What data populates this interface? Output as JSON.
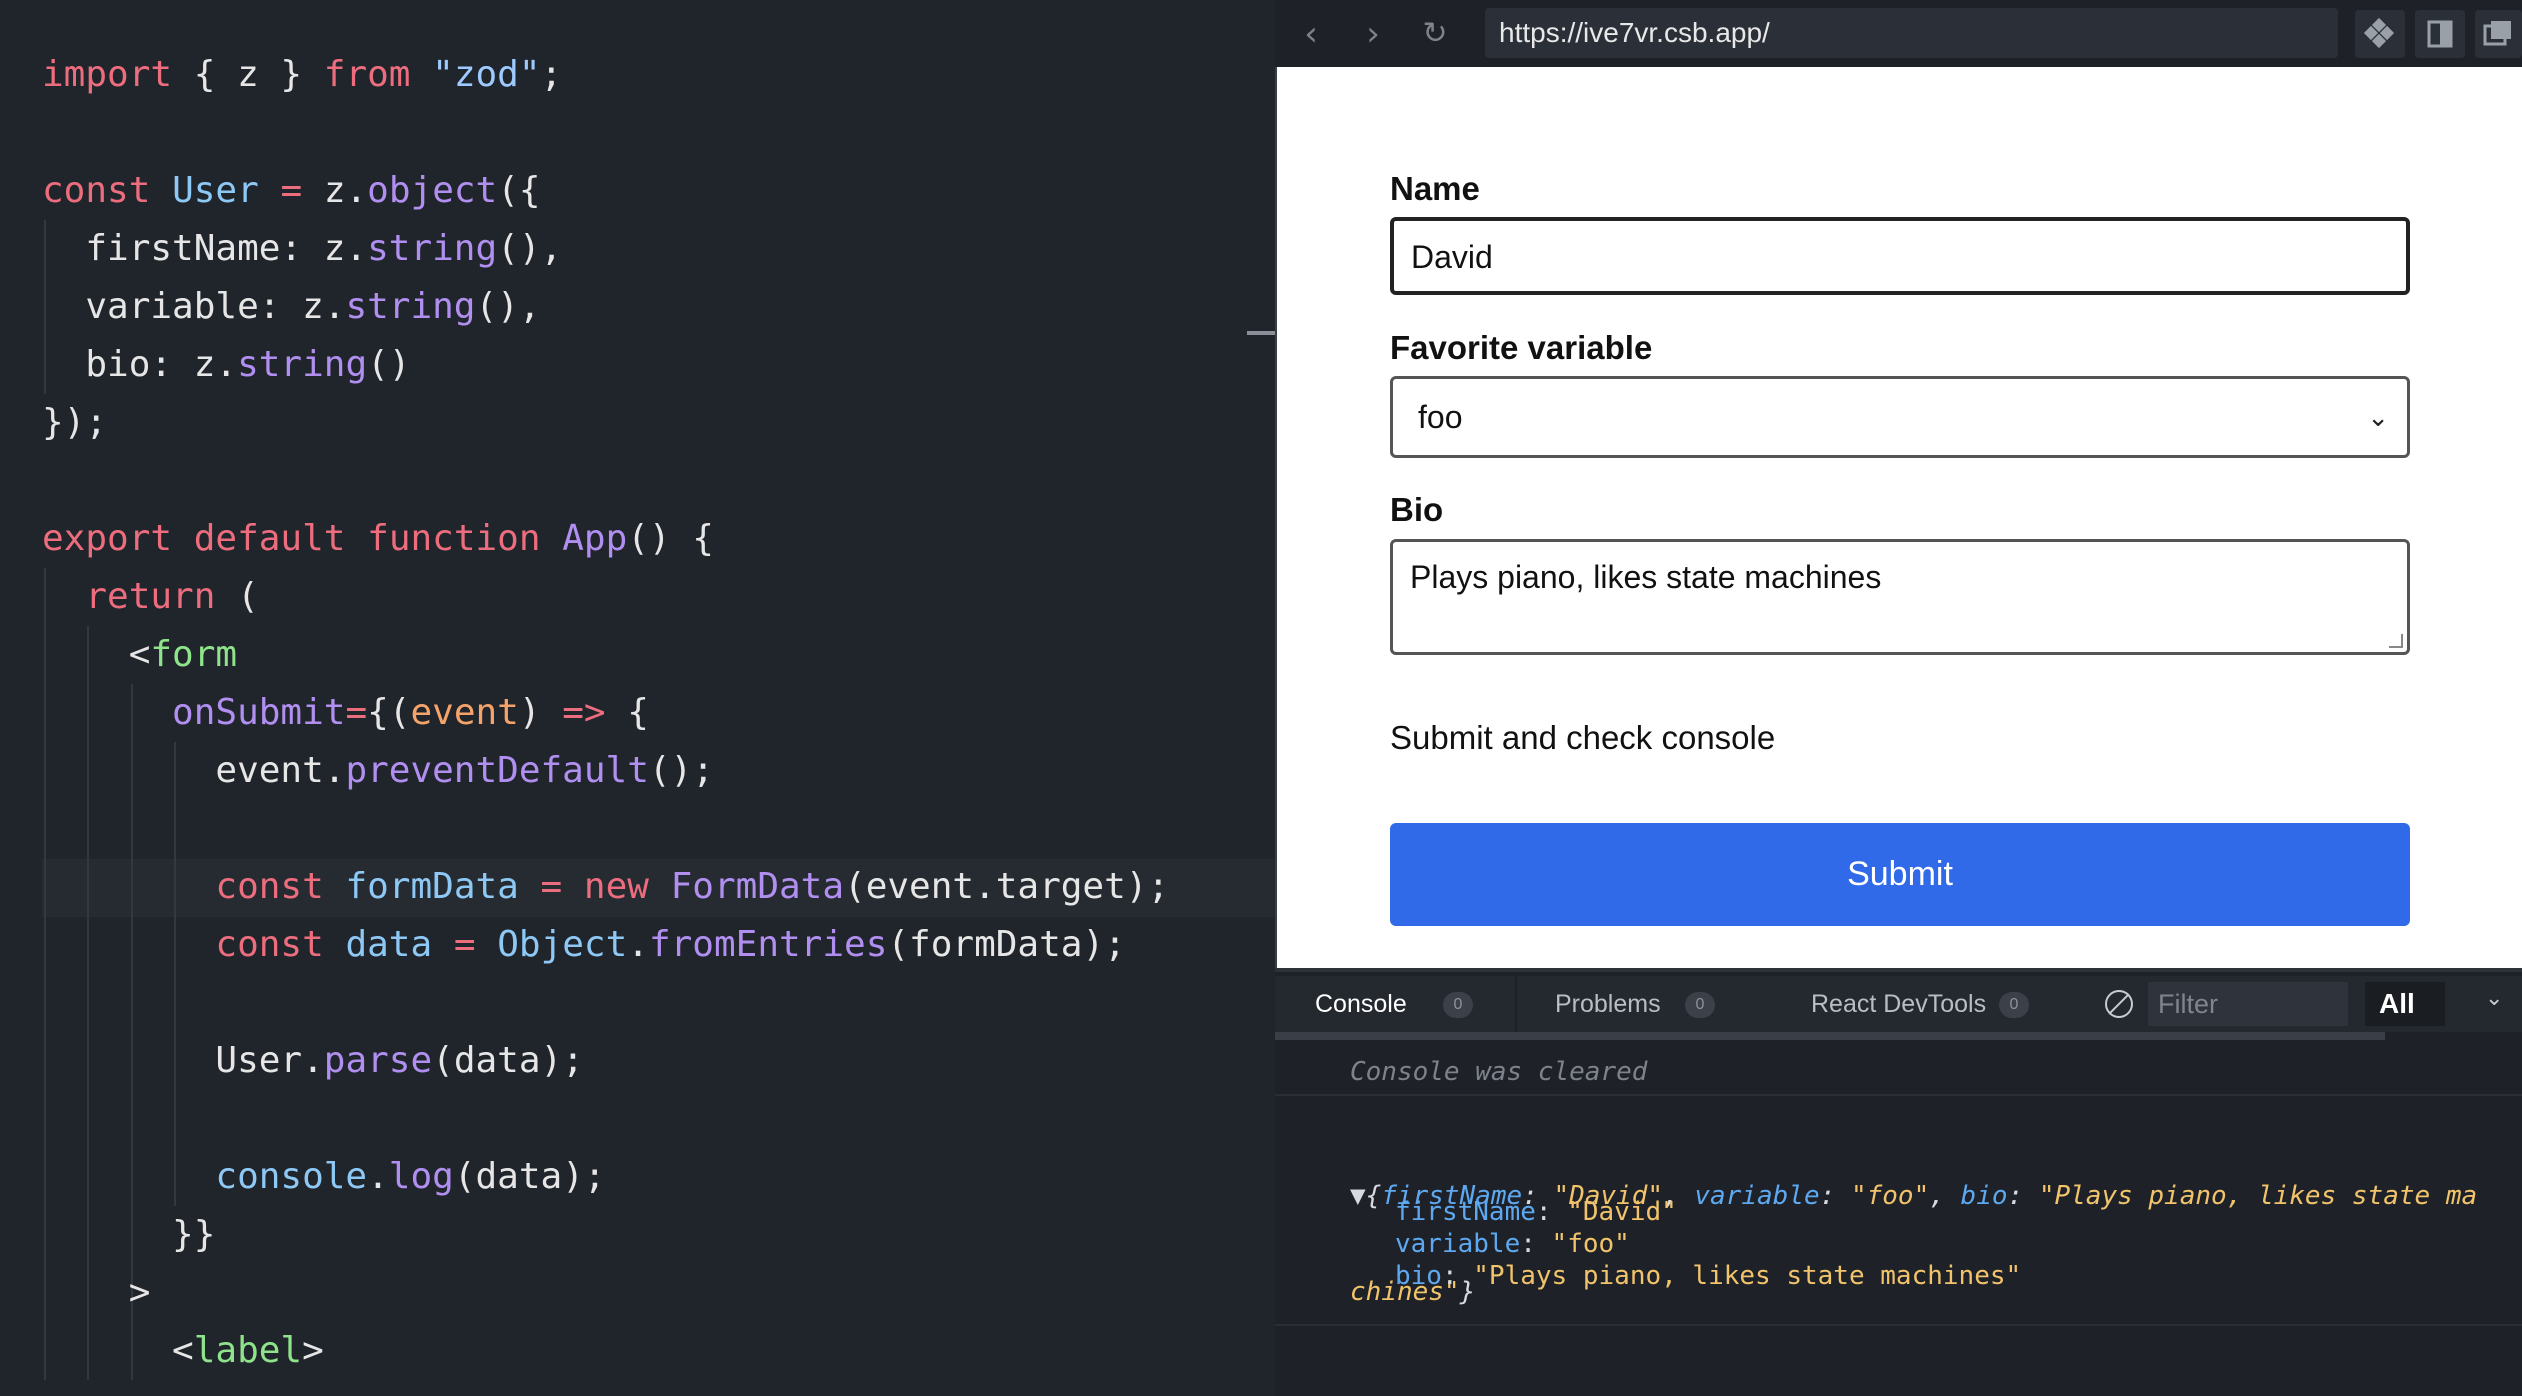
{
  "editor": {
    "lines": [
      {
        "parts": [
          [
            "kw",
            "import"
          ],
          [
            "p",
            " { z } "
          ],
          [
            "kw",
            "from"
          ],
          [
            "p",
            " "
          ],
          [
            "str",
            "\"zod\""
          ],
          [
            "p",
            ";"
          ]
        ]
      },
      {
        "parts": []
      },
      {
        "parts": [
          [
            "kw",
            "const"
          ],
          [
            "p",
            " "
          ],
          [
            "id",
            "User"
          ],
          [
            "p",
            " "
          ],
          [
            "kw",
            "="
          ],
          [
            "p",
            " z."
          ],
          [
            "fn",
            "object"
          ],
          [
            "p",
            "({"
          ]
        ]
      },
      {
        "parts": [
          [
            "p",
            "  firstName: z."
          ],
          [
            "fn",
            "string"
          ],
          [
            "p",
            "(),"
          ]
        ]
      },
      {
        "parts": [
          [
            "p",
            "  variable: z."
          ],
          [
            "fn",
            "string"
          ],
          [
            "p",
            "(),"
          ]
        ]
      },
      {
        "parts": [
          [
            "p",
            "  bio: z."
          ],
          [
            "fn",
            "string"
          ],
          [
            "p",
            "()"
          ]
        ]
      },
      {
        "parts": [
          [
            "p",
            "});"
          ]
        ]
      },
      {
        "parts": []
      },
      {
        "parts": [
          [
            "kw",
            "export"
          ],
          [
            "p",
            " "
          ],
          [
            "kw",
            "default"
          ],
          [
            "p",
            " "
          ],
          [
            "kw",
            "function"
          ],
          [
            "p",
            " "
          ],
          [
            "fn",
            "App"
          ],
          [
            "p",
            "() {"
          ]
        ]
      },
      {
        "parts": [
          [
            "p",
            "  "
          ],
          [
            "kw",
            "return"
          ],
          [
            "p",
            " ("
          ]
        ]
      },
      {
        "parts": [
          [
            "p",
            "    <"
          ],
          [
            "tag",
            "form"
          ]
        ]
      },
      {
        "parts": [
          [
            "p",
            "      "
          ],
          [
            "attr",
            "onSubmit"
          ],
          [
            "kw",
            "="
          ],
          [
            "p",
            "{("
          ],
          [
            "param",
            "event"
          ],
          [
            "p",
            ") "
          ],
          [
            "kw",
            "=>"
          ],
          [
            "p",
            " {"
          ]
        ]
      },
      {
        "parts": [
          [
            "p",
            "        event."
          ],
          [
            "fn",
            "preventDefault"
          ],
          [
            "p",
            "();"
          ]
        ]
      },
      {
        "parts": []
      },
      {
        "parts": [
          [
            "p",
            "        "
          ],
          [
            "kw",
            "const"
          ],
          [
            "p",
            " "
          ],
          [
            "id",
            "formData"
          ],
          [
            "p",
            " "
          ],
          [
            "kw",
            "="
          ],
          [
            "p",
            " "
          ],
          [
            "kw",
            "new"
          ],
          [
            "p",
            " "
          ],
          [
            "fn",
            "FormData"
          ],
          [
            "p",
            "(event.target);"
          ]
        ]
      },
      {
        "parts": [
          [
            "p",
            "        "
          ],
          [
            "kw",
            "const"
          ],
          [
            "p",
            " "
          ],
          [
            "id",
            "data"
          ],
          [
            "p",
            " "
          ],
          [
            "kw",
            "="
          ],
          [
            "p",
            " "
          ],
          [
            "id",
            "Object"
          ],
          [
            "p",
            "."
          ],
          [
            "fn",
            "fromEntries"
          ],
          [
            "p",
            "(formData);"
          ]
        ]
      },
      {
        "parts": []
      },
      {
        "parts": [
          [
            "p",
            "        User."
          ],
          [
            "fn",
            "parse"
          ],
          [
            "p",
            "(data);"
          ]
        ]
      },
      {
        "parts": []
      },
      {
        "parts": [
          [
            "p",
            "        "
          ],
          [
            "id",
            "console"
          ],
          [
            "p",
            "."
          ],
          [
            "fn",
            "log"
          ],
          [
            "p",
            "(data);"
          ]
        ]
      },
      {
        "parts": [
          [
            "p",
            "      }}"
          ]
        ]
      },
      {
        "parts": [
          [
            "p",
            "    >"
          ]
        ]
      },
      {
        "parts": [
          [
            "p",
            "      <"
          ],
          [
            "tag",
            "label"
          ],
          [
            "p",
            ">"
          ]
        ]
      }
    ]
  },
  "browser": {
    "url": "https://ive7vr.csb.app/",
    "back_icon": "chevron-left-icon",
    "forward_icon": "chevron-right-icon",
    "reload_icon": "reload-icon",
    "form": {
      "name_label": "Name",
      "name_value": "David",
      "variable_label": "Favorite variable",
      "variable_value": "foo",
      "bio_label": "Bio",
      "bio_value": "Plays piano, likes state machines",
      "hint": "Submit and check console",
      "submit_label": "Submit"
    },
    "accent_color": "#316ae8"
  },
  "console": {
    "tabs": [
      {
        "label": "Console",
        "count": "0"
      },
      {
        "label": "Problems",
        "count": "0"
      },
      {
        "label": "React DevTools",
        "count": "0"
      }
    ],
    "filter_placeholder": "Filter",
    "level": "All",
    "cleared_message": "Console was cleared",
    "log_summary_line1": "▼{firstName: \"David\", variable: \"foo\", bio: \"Plays piano, likes state ma",
    "log_summary_line2": "chines\"}",
    "log_props": [
      {
        "key": "firstName",
        "value": "\"David\""
      },
      {
        "key": "variable",
        "value": "\"foo\""
      },
      {
        "key": "bio",
        "value": "\"Plays piano, likes state machines\""
      }
    ]
  }
}
